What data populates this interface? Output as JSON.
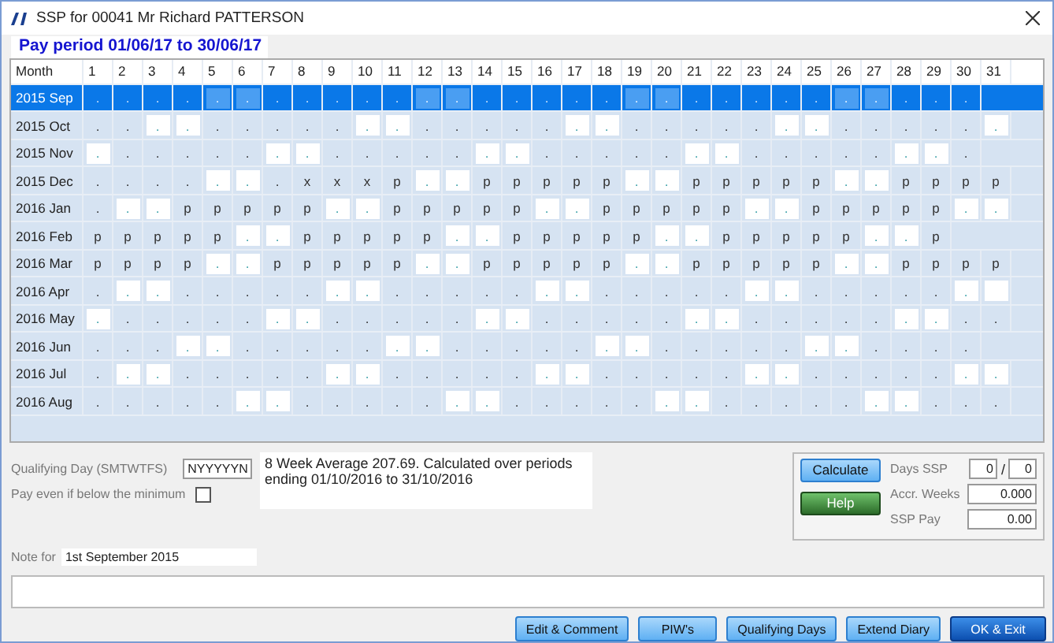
{
  "window": {
    "title": "SSP for 00041  Mr Richard PATTERSON"
  },
  "pay_period": "Pay period 01/06/17 to 30/06/17",
  "grid": {
    "month_header": "Month",
    "day_headers": [
      "1",
      "2",
      "3",
      "4",
      "5",
      "6",
      "7",
      "8",
      "9",
      "10",
      "11",
      "12",
      "13",
      "14",
      "15",
      "16",
      "17",
      "18",
      "19",
      "20",
      "21",
      "22",
      "23",
      "24",
      "25",
      "26",
      "27",
      "28",
      "29",
      "30",
      "31"
    ],
    "rows": [
      {
        "month": "2015 Sep",
        "selected": true,
        "cells": [
          ".",
          ".",
          ".",
          ".",
          ".",
          ".",
          ".",
          ".",
          ".",
          ".",
          ".",
          ".",
          ".",
          ".",
          ".",
          ".",
          ".",
          ".",
          ".",
          ".",
          ".",
          ".",
          ".",
          ".",
          ".",
          ".",
          ".",
          ".",
          ".",
          "."
        ],
        "weekend": [
          false,
          false,
          false,
          false,
          true,
          true,
          false,
          false,
          false,
          false,
          false,
          true,
          true,
          false,
          false,
          false,
          false,
          false,
          true,
          true,
          false,
          false,
          false,
          false,
          false,
          true,
          true,
          false,
          false,
          false
        ]
      },
      {
        "month": "2015 Oct",
        "selected": false,
        "cells": [
          ".",
          ".",
          ".",
          ".",
          ".",
          ".",
          ".",
          ".",
          ".",
          ".",
          ".",
          ".",
          ".",
          ".",
          ".",
          ".",
          ".",
          ".",
          ".",
          ".",
          ".",
          ".",
          ".",
          ".",
          ".",
          ".",
          ".",
          ".",
          ".",
          ".",
          "."
        ],
        "weekend": [
          false,
          false,
          true,
          true,
          false,
          false,
          false,
          false,
          false,
          true,
          true,
          false,
          false,
          false,
          false,
          false,
          true,
          true,
          false,
          false,
          false,
          false,
          false,
          true,
          true,
          false,
          false,
          false,
          false,
          false,
          true
        ]
      },
      {
        "month": "2015 Nov",
        "selected": false,
        "cells": [
          ".",
          ".",
          ".",
          ".",
          ".",
          ".",
          ".",
          ".",
          ".",
          ".",
          ".",
          ".",
          ".",
          ".",
          ".",
          ".",
          ".",
          ".",
          ".",
          ".",
          ".",
          ".",
          ".",
          ".",
          ".",
          ".",
          ".",
          ".",
          ".",
          "."
        ],
        "weekend": [
          true,
          false,
          false,
          false,
          false,
          false,
          true,
          true,
          false,
          false,
          false,
          false,
          false,
          true,
          true,
          false,
          false,
          false,
          false,
          false,
          true,
          true,
          false,
          false,
          false,
          false,
          false,
          true,
          true,
          false
        ]
      },
      {
        "month": "2015 Dec",
        "selected": false,
        "cells": [
          ".",
          ".",
          ".",
          ".",
          ".",
          ".",
          ".",
          "x",
          "x",
          "x",
          "p",
          ".",
          ".",
          "p",
          "p",
          "p",
          "p",
          "p",
          ".",
          ".",
          "p",
          "p",
          "p",
          "p",
          "p",
          ".",
          ".",
          "p",
          "p",
          "p",
          "p"
        ],
        "weekend": [
          false,
          false,
          false,
          false,
          true,
          true,
          false,
          false,
          false,
          false,
          false,
          true,
          true,
          false,
          false,
          false,
          false,
          false,
          true,
          true,
          false,
          false,
          false,
          false,
          false,
          true,
          true,
          false,
          false,
          false,
          false
        ]
      },
      {
        "month": "2016 Jan",
        "selected": false,
        "cells": [
          ".",
          ".",
          ".",
          "p",
          "p",
          "p",
          "p",
          "p",
          ".",
          ".",
          "p",
          "p",
          "p",
          "p",
          "p",
          ".",
          ".",
          "p",
          "p",
          "p",
          "p",
          "p",
          ".",
          ".",
          "p",
          "p",
          "p",
          "p",
          "p",
          ".",
          "."
        ],
        "weekend": [
          false,
          true,
          true,
          false,
          false,
          false,
          false,
          false,
          true,
          true,
          false,
          false,
          false,
          false,
          false,
          true,
          true,
          false,
          false,
          false,
          false,
          false,
          true,
          true,
          false,
          false,
          false,
          false,
          false,
          true,
          true
        ]
      },
      {
        "month": "2016 Feb",
        "selected": false,
        "cells": [
          "p",
          "p",
          "p",
          "p",
          "p",
          ".",
          ".",
          "p",
          "p",
          "p",
          "p",
          "p",
          ".",
          ".",
          "p",
          "p",
          "p",
          "p",
          "p",
          ".",
          ".",
          "p",
          "p",
          "p",
          "p",
          "p",
          ".",
          ".",
          "p"
        ],
        "weekend": [
          false,
          false,
          false,
          false,
          false,
          true,
          true,
          false,
          false,
          false,
          false,
          false,
          true,
          true,
          false,
          false,
          false,
          false,
          false,
          true,
          true,
          false,
          false,
          false,
          false,
          false,
          true,
          true,
          false
        ]
      },
      {
        "month": "2016 Mar",
        "selected": false,
        "cells": [
          "p",
          "p",
          "p",
          "p",
          ".",
          ".",
          "p",
          "p",
          "p",
          "p",
          "p",
          ".",
          ".",
          "p",
          "p",
          "p",
          "p",
          "p",
          ".",
          ".",
          "p",
          "p",
          "p",
          "p",
          "p",
          ".",
          ".",
          "p",
          "p",
          "p",
          "p"
        ],
        "weekend": [
          false,
          false,
          false,
          false,
          true,
          true,
          false,
          false,
          false,
          false,
          false,
          true,
          true,
          false,
          false,
          false,
          false,
          false,
          true,
          true,
          false,
          false,
          false,
          false,
          false,
          true,
          true,
          false,
          false,
          false,
          false
        ]
      },
      {
        "month": "2016 Apr",
        "selected": false,
        "cells": [
          ".",
          ".",
          ".",
          ".",
          ".",
          ".",
          ".",
          ".",
          ".",
          ".",
          ".",
          ".",
          ".",
          ".",
          ".",
          ".",
          ".",
          ".",
          ".",
          ".",
          ".",
          ".",
          ".",
          ".",
          ".",
          ".",
          ".",
          ".",
          ".",
          ".",
          " "
        ],
        "weekend": [
          false,
          true,
          true,
          false,
          false,
          false,
          false,
          false,
          true,
          true,
          false,
          false,
          false,
          false,
          false,
          true,
          true,
          false,
          false,
          false,
          false,
          false,
          true,
          true,
          false,
          false,
          false,
          false,
          false,
          true,
          true
        ]
      },
      {
        "month": "2016 May",
        "selected": false,
        "cells": [
          ".",
          ".",
          ".",
          ".",
          ".",
          ".",
          ".",
          ".",
          ".",
          ".",
          ".",
          ".",
          ".",
          ".",
          ".",
          ".",
          ".",
          ".",
          ".",
          ".",
          ".",
          ".",
          ".",
          ".",
          ".",
          ".",
          ".",
          ".",
          ".",
          ".",
          "."
        ],
        "weekend": [
          true,
          false,
          false,
          false,
          false,
          false,
          true,
          true,
          false,
          false,
          false,
          false,
          false,
          true,
          true,
          false,
          false,
          false,
          false,
          false,
          true,
          true,
          false,
          false,
          false,
          false,
          false,
          true,
          true,
          false,
          false
        ]
      },
      {
        "month": "2016 Jun",
        "selected": false,
        "cells": [
          ".",
          ".",
          ".",
          ".",
          ".",
          ".",
          ".",
          ".",
          ".",
          ".",
          ".",
          ".",
          ".",
          ".",
          ".",
          ".",
          ".",
          ".",
          ".",
          ".",
          ".",
          ".",
          ".",
          ".",
          ".",
          ".",
          ".",
          ".",
          ".",
          "."
        ],
        "weekend": [
          false,
          false,
          false,
          true,
          true,
          false,
          false,
          false,
          false,
          false,
          true,
          true,
          false,
          false,
          false,
          false,
          false,
          true,
          true,
          false,
          false,
          false,
          false,
          false,
          true,
          true,
          false,
          false,
          false,
          false
        ]
      },
      {
        "month": "2016 Jul",
        "selected": false,
        "cells": [
          ".",
          ".",
          ".",
          ".",
          ".",
          ".",
          ".",
          ".",
          ".",
          ".",
          ".",
          ".",
          ".",
          ".",
          ".",
          ".",
          ".",
          ".",
          ".",
          ".",
          ".",
          ".",
          ".",
          ".",
          ".",
          ".",
          ".",
          ".",
          ".",
          ".",
          "."
        ],
        "weekend": [
          false,
          true,
          true,
          false,
          false,
          false,
          false,
          false,
          true,
          true,
          false,
          false,
          false,
          false,
          false,
          true,
          true,
          false,
          false,
          false,
          false,
          false,
          true,
          true,
          false,
          false,
          false,
          false,
          false,
          true,
          true
        ]
      },
      {
        "month": "2016 Aug",
        "selected": false,
        "cells": [
          ".",
          ".",
          ".",
          ".",
          ".",
          ".",
          ".",
          ".",
          ".",
          ".",
          ".",
          ".",
          ".",
          ".",
          ".",
          ".",
          ".",
          ".",
          ".",
          ".",
          ".",
          ".",
          ".",
          ".",
          ".",
          ".",
          ".",
          ".",
          ".",
          ".",
          "."
        ],
        "weekend": [
          false,
          false,
          false,
          false,
          false,
          true,
          true,
          false,
          false,
          false,
          false,
          false,
          true,
          true,
          false,
          false,
          false,
          false,
          false,
          true,
          true,
          false,
          false,
          false,
          false,
          false,
          true,
          true,
          false,
          false,
          false
        ]
      }
    ]
  },
  "qualifying_day": {
    "label": "Qualifying Day (SMTWTFS)",
    "value": "NYYYYYN"
  },
  "pay_even": {
    "label": "Pay even if below the minimum",
    "checked": false
  },
  "average_text": "8 Week Average 207.69. Calculated over periods ending 01/10/2016 to 31/10/2016",
  "calc": {
    "calculate": "Calculate",
    "help": "Help",
    "days_ssp": {
      "label": "Days SSP",
      "value": "0",
      "separator": "/",
      "total": "0"
    },
    "accr_weeks": {
      "label": "Accr. Weeks",
      "value": "0.000"
    },
    "ssp_pay": {
      "label": "SSP Pay",
      "value": "0.00"
    }
  },
  "note": {
    "label": "Note for",
    "value": "1st September 2015"
  },
  "buttons": [
    {
      "label": "Edit & Comment",
      "kind": "normal"
    },
    {
      "label": "PIW's",
      "kind": "normal"
    },
    {
      "label": "Qualifying Days",
      "kind": "normal"
    },
    {
      "label": "Extend Diary",
      "kind": "normal"
    },
    {
      "label": "OK & Exit",
      "kind": "primary"
    }
  ]
}
